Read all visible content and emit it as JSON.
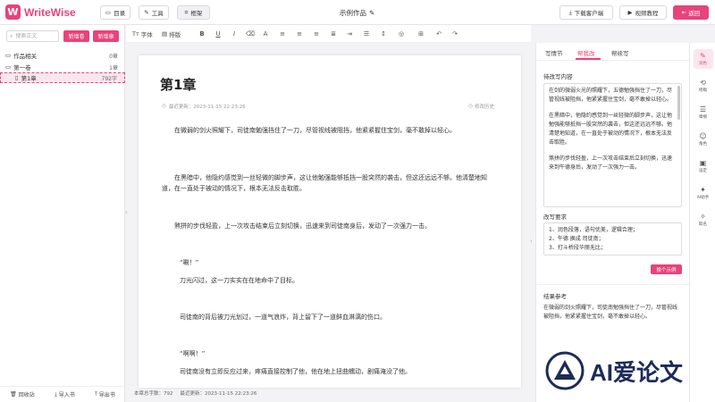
{
  "app": {
    "name": "WriteWise",
    "logo_letter": "W"
  },
  "header": {
    "buttons": {
      "toc": "目录",
      "tools": "工具",
      "frame": "框架"
    },
    "doc_title": "示例作品",
    "download_client": "下载客户端",
    "video_tutorial": "视频教程",
    "back": "返回"
  },
  "sidebar": {
    "search_placeholder": "搜索正文",
    "new_volume": "新增卷",
    "new_chapter": "新增章",
    "tree": [
      {
        "label": "作品相关",
        "count": "0章"
      },
      {
        "label": "第一卷",
        "count": "1章"
      },
      {
        "label": "第1章",
        "count": "792字"
      }
    ],
    "footer": {
      "recycle": "回收站",
      "import": "导入书",
      "export": "导出书"
    }
  },
  "toolbar": {
    "font": "字体",
    "layout": "排版",
    "font_prefix": "Tт"
  },
  "editor": {
    "chapter_title": "第1章",
    "last_update": "最近更新：2023-11-15 22:23:26",
    "history": "修改历史",
    "paragraphs": [
      "在微弱的剑火照耀下，司徒南勉强挡住了一刀，尽管视线被阻挡，他紧紧握住宝剑，毫不敢掉以轻心。",
      "在黑暗中，他隐约感觉到一丝轻微的脚步声，这让他勉强能够抵挡一股突然的袭击，但这还远远不够。他清楚地知道，在一直处于被动的情况下，根本无法反击取胜。",
      "煞拼的步伐轻盈，上一次攻击结束后立刻切换，迅速来到司徒南身后，发动了一次强力一击。",
      "“唰！”",
      "刀光闪过，这一刀实实在在地命中了目标。",
      "司徒南的背后被刀光划过，一道气浪炸，背上留下了一道鲜血淋漓的伤口。",
      "“啊啊！”",
      "司徒南没有立即反应过来，疼痛直接控制了他，他在地上扭曲蠕动，剧痛淹没了他。"
    ],
    "status": {
      "words": "本章总字数：792",
      "updated": "最近更新：2023-11-15 22:23:26"
    }
  },
  "right_panel": {
    "tabs": [
      "写情节",
      "帮我改",
      "帮续写"
    ],
    "active_tab": 1,
    "pending_label": "待改写内容",
    "pending_paragraphs": [
      "在剑的微弱火光的照耀下，五德勉强挡住了一刀，尽管视线被阻挡，他紧紧握住宝剑，毫不敢掉以轻心。",
      "在黑暗中，他隐约感觉到一丝轻微的脚步声，这让他勉强能够抵挡一股突然的袭击，但这还远远不够。他清楚地知道，在一直处于被动的情况下，根本无法反击取胜。",
      "煞拼的步伐轻盈，上一次攻击结束后立刻切换，迅速来到午德身后，发动了一次强力一击。"
    ],
    "requirement_label": "改写要求",
    "requirements": [
      "1、润色段落，语句优美，逻辑合理；",
      "2、午德 换成 司徒南；",
      "3、打斗桥段华丽无比；"
    ],
    "example_button": "换个示例",
    "result_label": "结果参考",
    "result_text": "在微弱的剑火照耀下，司徒南勉强挡住了一刀，尽管视线被阻挡，他紧紧握住宝剑，毫不敢掉以轻心。"
  },
  "rail": [
    {
      "label": "润色",
      "glyph": "✎",
      "active": true
    },
    {
      "label": "修稿",
      "glyph": "⟲"
    },
    {
      "label": "章纲",
      "glyph": "☰"
    },
    {
      "label": "角色",
      "glyph": "☺"
    },
    {
      "label": "设定",
      "glyph": "▣"
    },
    {
      "label": "AI助手",
      "glyph": "✦"
    },
    {
      "label": "取名",
      "glyph": "✧"
    }
  ],
  "watermark": {
    "text": "AI爱论文"
  },
  "colors": {
    "accent": "#e8437a",
    "watermark": "#1d2b5a"
  }
}
